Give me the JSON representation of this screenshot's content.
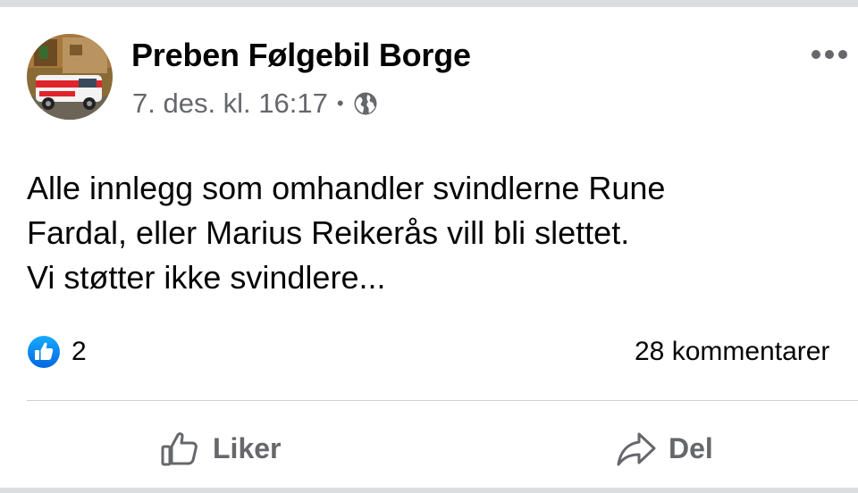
{
  "post": {
    "author": "Preben Følgebil Borge",
    "timestamp": "7. des. kl. 16:17",
    "meta_separator": "•",
    "privacy_icon": "globe-icon",
    "options_icon": "more-horizontal-icon",
    "text_lines": [
      "Alle innlegg som omhandler svindlerne Rune",
      "Fardal, eller Marius Reikerås vill bli slettet.",
      "Vi støtter ikke svindlere..."
    ]
  },
  "stats": {
    "reaction_icon": "like-reaction-icon",
    "like_count": "2",
    "comments": "28 kommentarer"
  },
  "actions": {
    "like_label": "Liker",
    "like_icon": "thumbs-up-icon",
    "share_label": "Del",
    "share_icon": "share-arrow-icon"
  },
  "colors": {
    "like_blue": "#1877f2",
    "text_primary": "#050505",
    "text_secondary": "#65676b",
    "divider": "#ced0d4"
  }
}
